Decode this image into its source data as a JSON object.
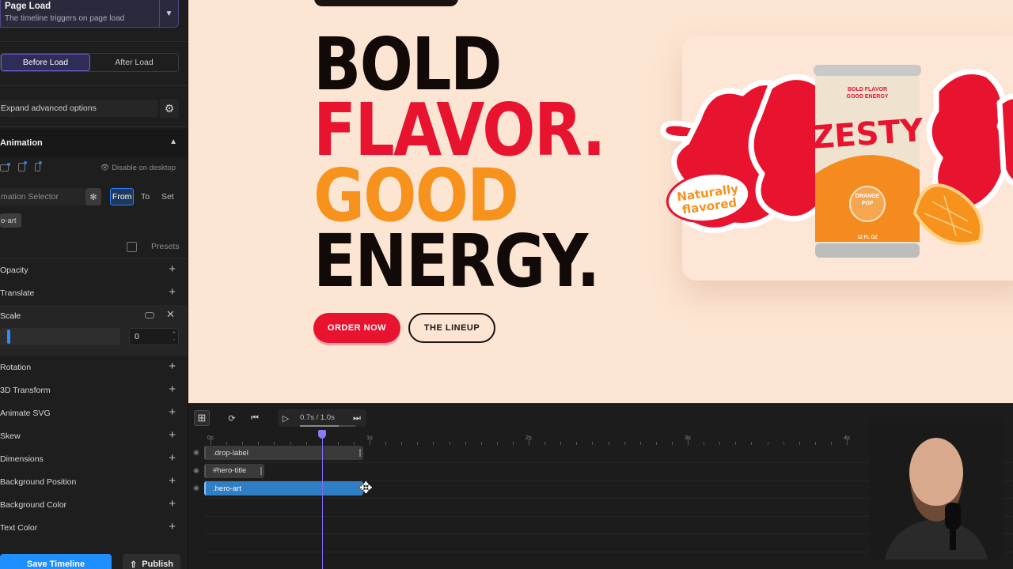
{
  "trigger": {
    "title": "Page Load",
    "subtitle": "The timeline triggers on page load"
  },
  "load_tabs": [
    {
      "label": "Before Load",
      "active": true
    },
    {
      "label": "After Load",
      "active": false
    }
  ],
  "advanced": {
    "label": "Expand advanced options"
  },
  "animation": {
    "header": "Animation",
    "disable_desktop": "Disable on desktop",
    "selector_placeholder": "mation Selector",
    "modes": [
      "From",
      "To",
      "Set"
    ],
    "active_mode": "From",
    "chip": "o-art",
    "presets": "Presets",
    "properties_top": [
      "Opacity",
      "Translate"
    ],
    "scale": {
      "label": "Scale",
      "value": "0",
      "slider_fraction": 0.06
    },
    "properties_bottom": [
      "Rotation",
      "3D Transform",
      "Animate SVG",
      "Skew",
      "Dimensions",
      "Background Position",
      "Background Color",
      "Text Color"
    ]
  },
  "footer": {
    "save": "Save Timeline",
    "publish": "Publish"
  },
  "hero": {
    "lines": [
      {
        "text": "BOLD",
        "color": "#120a08"
      },
      {
        "text": "FLAVOR.",
        "color": "#e8132e"
      },
      {
        "text": "GOOD",
        "color": "#f7921c"
      },
      {
        "text": "ENERGY.",
        "color": "#120a08"
      }
    ],
    "primary_button": "ORDER NOW",
    "secondary_button": "THE LINEUP"
  },
  "art": {
    "can_top_text": "BOLD FLAVOR GOOD ENERGY",
    "brand": "ZESTY",
    "flavor": "ORANGE POP",
    "volume": "12 FL OZ",
    "sticker": "Naturally flavored"
  },
  "timeline": {
    "time_display": "0.7s / 1.0s",
    "progress": 0.7,
    "ruler_labels": [
      "0s",
      "1s",
      "2s",
      "3s",
      "4s"
    ],
    "playhead_seconds": 0.7,
    "tracks": [
      {
        "label": ".drop-label",
        "start": 0,
        "end": 1.0,
        "selected": false
      },
      {
        "label": "#hero-title",
        "start": 0,
        "end": 0.38,
        "selected": false
      },
      {
        "label": ".hero-art",
        "start": 0,
        "end": 1.0,
        "selected": true
      }
    ]
  }
}
